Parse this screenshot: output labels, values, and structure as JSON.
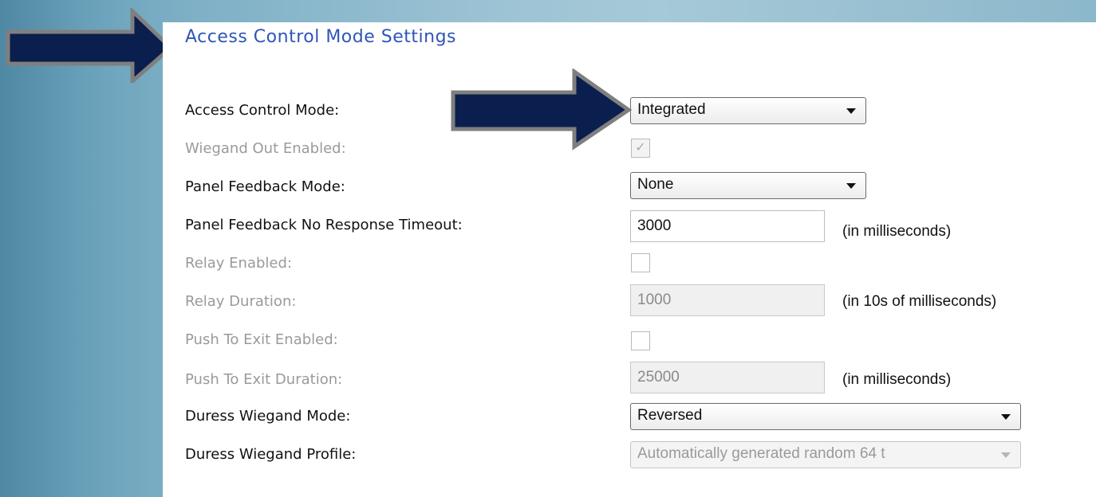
{
  "section": {
    "title": "Access Control Mode Settings"
  },
  "fields": {
    "access_control_mode": {
      "label": "Access Control Mode:",
      "value": "Integrated"
    },
    "wiegand_out_enabled": {
      "label": "Wiegand Out Enabled:",
      "checked": true
    },
    "panel_feedback_mode": {
      "label": "Panel Feedback Mode:",
      "value": "None"
    },
    "panel_feedback_timeout": {
      "label": "Panel Feedback No Response Timeout:",
      "value": "3000",
      "unit": "(in milliseconds)"
    },
    "relay_enabled": {
      "label": "Relay Enabled:",
      "checked": false
    },
    "relay_duration": {
      "label": "Relay Duration:",
      "value": "1000",
      "unit": "(in 10s of milliseconds)"
    },
    "push_to_exit_enabled": {
      "label": "Push To Exit Enabled:",
      "checked": false
    },
    "push_to_exit_duration": {
      "label": "Push To Exit Duration:",
      "value": "25000",
      "unit": "(in milliseconds)"
    },
    "duress_wiegand_mode": {
      "label": "Duress Wiegand Mode:",
      "value": "Reversed"
    },
    "duress_wiegand_profile": {
      "label": "Duress Wiegand Profile:",
      "value": "Automatically generated random 64 t"
    }
  },
  "colors": {
    "arrow_fill": "#0a1f4e",
    "arrow_outline": "#7f7f7f",
    "title": "#2e55b8"
  },
  "icons": {
    "arrow_annotation": "right-arrow-icon",
    "dropdown_caret": "chevron-down-icon",
    "checkmark": "checkmark-icon"
  }
}
